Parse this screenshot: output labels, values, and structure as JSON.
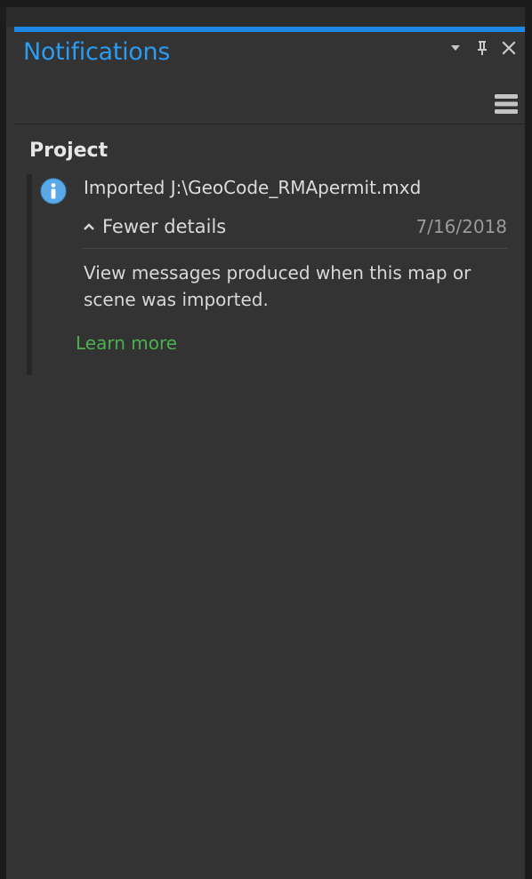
{
  "panel": {
    "title": "Notifications"
  },
  "group": {
    "heading": "Project"
  },
  "notification": {
    "icon": "info-icon",
    "message": "Imported J:\\GeoCode_RMApermit.mxd",
    "details_toggle": "Fewer details",
    "date": "7/16/2018",
    "description": "View messages produced when this map or scene was imported.",
    "learn_more": "Learn more"
  },
  "colors": {
    "accent": "#1e88e5",
    "title": "#2a9bf0",
    "link": "#4caf50",
    "info_icon": "#5aa9e6"
  }
}
